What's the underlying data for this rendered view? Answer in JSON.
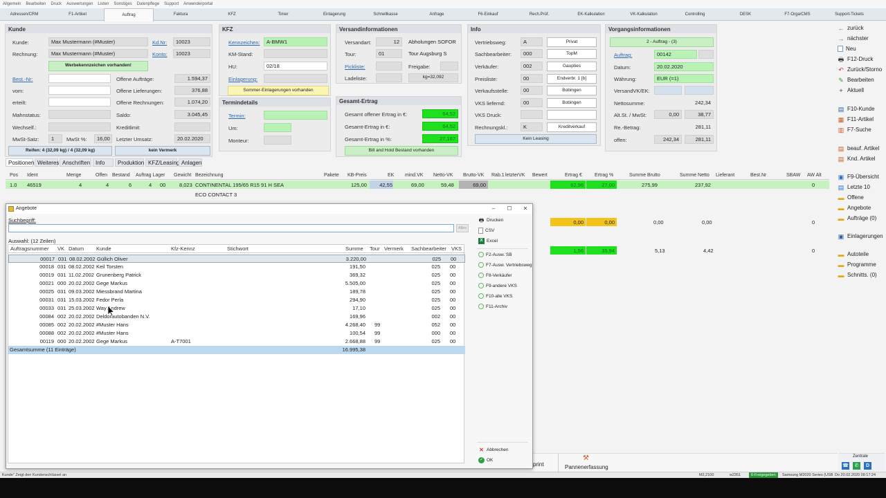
{
  "menu": [
    "Allgemein",
    "Bearbeiten",
    "Druck",
    "Auswertungen",
    "Listen",
    "Sonstiges",
    "Datenpflege",
    "Support",
    "Anwenderportal"
  ],
  "nav_tabs": [
    "Adressen/CRM",
    "F1-Artikel",
    "Auftrag",
    "Faktura",
    "KFZ",
    "Timer",
    "Einlagerung",
    "Schnellkasse",
    "Anfrage",
    "F6-Einkauf",
    "Rech.Prüf.",
    "EK-Kalkulation",
    "VK-Kalkulation",
    "Controlling",
    "DESK",
    "F7-Orga/CMS",
    "Support-Tickets"
  ],
  "active_tab": "Auftrag",
  "kunde": {
    "title": "Kunde",
    "kunde_label": "Kunde:",
    "kunde_value": "Max Mustermann (#Muster)",
    "kdnr_label": "Kd.Nr:",
    "kdnr_value": "10023",
    "rechnung_label": "Rechnung:",
    "rechnung_value": "Max Mustermann (#Muster)",
    "konto_label": "Konto:",
    "konto_value": "10023",
    "werbe_btn": "Werbekennzeichen vorhanden!",
    "best_label": "Best.-Nr:",
    "vom_label": "vom:",
    "erteilt_label": "erteilt:",
    "mahn_label": "Mahnstatus:",
    "wechsel_label": "Wechself.:",
    "mwst_satz_label": "MwSt-Satz:",
    "mwst_satz_value": "1",
    "mwst_pct_label": "MwSt %:",
    "mwst_pct_value": "16,00",
    "offene_auftraege_label": "Offene Aufträge:",
    "offene_auftraege_value": "1.594,37",
    "offene_lief_label": "Offene Lieferungen:",
    "offene_lief_value": "376,88",
    "offene_rech_label": "Offene Rechnungen:",
    "offene_rech_value": "1.074,20",
    "saldo_label": "Saldo:",
    "saldo_value": "3.045,45",
    "kreditlimit_label": "Kreditlimit:",
    "letzter_umsatz_label": "Letzter Umsatz:",
    "letzter_umsatz_value": "20.02.2020",
    "reifen_btn": "Reifen: 4 (32,09 kg) / 4 (32,09 kg)",
    "vermerk_btn": "kein Vermerk"
  },
  "kfz": {
    "title": "KFZ",
    "kennzeichen_label": "Kennzeichen:",
    "kennzeichen_value": "A-BMW1",
    "km_label": "KM-Stand:",
    "hu_label": "HU:",
    "hu_value": "02/18",
    "einlagerung_label": "Einlagerung:",
    "sommer_btn": "Sommer-Einlagerungen vorhanden"
  },
  "termin": {
    "title": "Termindetails",
    "termin_label": "Termin:",
    "um_label": "Um:",
    "monteur_label": "Monteur:"
  },
  "versand": {
    "title": "Versandinformationen",
    "versandart_label": "Versandart:",
    "versandart_value": "12",
    "versandart_text": "Abholungen SOFOR",
    "tour_label": "Tour:",
    "tour_value": "01",
    "tour_text": "Tour Augsburg S",
    "pickliste_label": "Pickliste:",
    "freigabe_label": "Freigabe:",
    "ladeliste_label": "Ladeliste:",
    "kg_value": "kg=32,092"
  },
  "ertrag": {
    "title": "Gesamt-Ertrag",
    "offen_label": "Gesamt offener Ertrag in €:",
    "offen_value": "64,52",
    "eur_label": "Gesamt-Ertrag in €:",
    "eur_value": "64,52",
    "pct_label": "Gesamt-Ertrag in %:",
    "pct_value": "27,167",
    "bill_btn": "Bill and Hold Bestand vorhanden"
  },
  "info": {
    "title": "Info",
    "vertriebsweg_label": "Vertriebsweg:",
    "vertriebsweg_value": "A",
    "vertriebsweg_btn": "Privat",
    "sachbearbeiter_label": "Sachbearbeiter:",
    "sachbearbeiter_value": "000",
    "sachbearbeiter_btn": "TopM",
    "verkaeufer_label": "Verkäufer:",
    "verkaeufer_value": "002",
    "verkaeufer_btn": "Gaupties",
    "preisliste_label": "Preisliste:",
    "preisliste_value": "00",
    "preisliste_btn": "Endverbr. 1 [b]",
    "vkstelle_label": "Verkaufsstelle:",
    "vkstelle_value": "00",
    "vkstelle_btn": "Bobingen",
    "vks_liefernd_label": "VKS liefernd:",
    "vks_liefernd_value": "00",
    "vks_liefernd_btn": "Bobingen",
    "vks_druck_label": "VKS Druck:",
    "rechnungskl_label": "Rechnungskl.:",
    "rechnungskl_value": "K",
    "rechnungskl_btn": "Kreditverkauf",
    "leasing_btn": "Kein Leasing"
  },
  "vorgang": {
    "title": "Vorgangsinformationen",
    "auftrag_btn": "2 - Auftrag - (3)",
    "auftrag_label": "Auftrag:",
    "auftrag_value": "00142",
    "datum_label": "Datum:",
    "datum_value": "20.02.2020",
    "waehrung_label": "Währung:",
    "waehrung_value": "EUR (=1)",
    "versandvk_label": "VersandVK/EK:",
    "netto_label": "Nettosumme:",
    "netto_value": "242,34",
    "altst_label": "Alt.St. / MwSt:",
    "altst_value": "0,00",
    "mwst_value": "38,77",
    "rebetrag_label": "Re.-Betrag:",
    "rebetrag_value": "281,11",
    "offen_label": "offen:",
    "offen_value1": "242,34",
    "offen_value2": "281,11"
  },
  "subtabs": [
    "Positionen",
    "Weiteres",
    "Anschriften",
    "Info",
    "Produktion",
    "KFZ/Leasing",
    "Anlagen"
  ],
  "positions": {
    "headers": [
      "Pos",
      "Ident",
      "Menge",
      "Offen",
      "Bestand",
      "Auftrag Lager",
      "Gewicht",
      "Bezeichnung",
      "Pakete",
      "KB-Preis",
      "EK",
      "mind.VK",
      "Netto-VK",
      "Brutto-VK",
      "Rab.1",
      "letzterVK",
      "Bewert",
      "Ertrag €",
      "Ertrag %",
      "Summe Brutto",
      "Summe Netto",
      "Lieferant",
      "Best.Nr",
      "SBAW",
      "AW Alt"
    ],
    "row": {
      "pos": "1.0",
      "ident": "46519",
      "menge": "4",
      "offen": "4",
      "bestand": "6",
      "lager": "00",
      "gewicht": "8,023",
      "bezeichnung": "CONTINENTAL  195/65 R15 91 H SEA",
      "kb_preis": "125,00",
      "ek": "42,55",
      "mind_vk": "69,00",
      "netto_vk": "59,48",
      "brutto_vk": "69,00",
      "ertrag_eur": "62,96",
      "ertrag_pct": "27,00",
      "summe_brutto": "275,99",
      "summe_netto": "237,92",
      "sbaw": "0"
    },
    "sub_line": "ECO CONTACT 3",
    "row2": {
      "ertrag_eur": "0,00",
      "ertrag_pct": "0,00",
      "summe_brutto": "0,00",
      "summe_netto": "0,00",
      "sbaw": "0"
    },
    "row3": {
      "ertrag_eur": "1,56",
      "ertrag_pct": "35,94",
      "summe_brutto": "5,13",
      "summe_netto": "4,42",
      "sbaw": "0"
    }
  },
  "right_panel": {
    "group1": [
      "zurück",
      "nächster",
      "Neu",
      "F12-Druck",
      "Zurück/Storno",
      "Bearbeiten",
      "Aktuell"
    ],
    "group2": [
      "F10-Kunde",
      "F11-Artikel",
      "F7-Suche"
    ],
    "group3": [
      "beauf. Artikel",
      "Knd. Artikel"
    ],
    "group4": [
      "F9-Übersicht",
      "Letzte 10",
      "Offene",
      "Angebote",
      "Aufträge (0)"
    ],
    "group5": [
      "Einlagerungen"
    ],
    "group6": [
      "Autoteile",
      "Programme",
      "Schnitts. (0)"
    ]
  },
  "dialog": {
    "title": "Angebote",
    "search_label": "Suchbegriff:",
    "search_value": "",
    "search_btn": "Alles",
    "auswahl": "Auswahl: (12 Zeilen)",
    "headers": [
      "Auftragsnummer",
      "VK",
      "Datum",
      "Kunde",
      "Kfz-Kennz",
      "Stichwort",
      "Summe",
      "Tour",
      "Vermerk",
      "Sachbearbeiter",
      "VKS"
    ],
    "rows": [
      [
        "00017",
        "031",
        "08.02.2002",
        "Güllich Oliver",
        "",
        "",
        "3.220,00",
        "",
        "",
        "025",
        "00"
      ],
      [
        "00018",
        "031",
        "08.02.2002",
        "Keil Torsten",
        "",
        "",
        "191,50",
        "",
        "",
        "025",
        "00"
      ],
      [
        "00019",
        "031",
        "11.02.2002",
        "Grunenberg Patrick",
        "",
        "",
        "369,32",
        "",
        "",
        "025",
        "00"
      ],
      [
        "00021",
        "000",
        "20.02.2002",
        "Gege Markus",
        "",
        "",
        "5.505,00",
        "",
        "",
        "025",
        "00"
      ],
      [
        "00025",
        "031",
        "09.03.2002",
        "Miessbrand Martina",
        "",
        "",
        "189,78",
        "",
        "",
        "025",
        "00"
      ],
      [
        "00031",
        "031",
        "15.03.2002",
        "Fedor Perla",
        "",
        "",
        "294,90",
        "",
        "",
        "025",
        "00"
      ],
      [
        "00033",
        "031",
        "25.03.2002",
        "Way Andrew",
        "",
        "",
        "17,10",
        "",
        "",
        "025",
        "00"
      ],
      [
        "00084",
        "002",
        "20.02.2002",
        "Deldorautobanden N.V.",
        "",
        "",
        "169,96",
        "",
        "",
        "002",
        "00"
      ],
      [
        "00085",
        "002",
        "20.02.2002",
        "#Muster Hans",
        "",
        "",
        "4.268,40",
        "99",
        "",
        "052",
        "00"
      ],
      [
        "00088",
        "002",
        "20.02.2002",
        "#Muster Hans",
        "",
        "",
        "100,54",
        "99",
        "",
        "000",
        "00"
      ],
      [
        "00119",
        "000",
        "20.02.2002",
        "Gege Markus",
        "A-T7001",
        "",
        "2.668,88",
        "99",
        "",
        "025",
        "00"
      ]
    ],
    "total_label": "Gesamtsumme  (11 Einträge)",
    "total_value": "16.995,38",
    "side_actions": [
      "Drucken",
      "CSV",
      "Excel"
    ],
    "side_filters": [
      "F2-Ausw. SB",
      "F7-Ausw. Vertriebsweg",
      "F8-Verkäufer",
      "F9-andere VKS",
      "F10-alle VKS",
      "F11-Archiv"
    ],
    "cancel_label": "Abbrechen",
    "ok_label": "OK"
  },
  "bottom": {
    "print_label": "print",
    "panne_label": "Pannenerfassung",
    "zentrale_label": "Zentrale"
  },
  "status": {
    "hint": "Kunde\" Zeigt den Kundenschlüssel an",
    "user": "M2,2100",
    "w": "w2351",
    "freigabe": "6-Freigegeben",
    "printer": "Samsung M2020 Series (USB",
    "date": "Do 20.02.2020 09:17:24"
  },
  "colors": {
    "green_field": "#b9f2b5",
    "profit_green": "#1fe01f",
    "warn_yellow": "#f2c31b",
    "selection": "#bcd8ef"
  }
}
